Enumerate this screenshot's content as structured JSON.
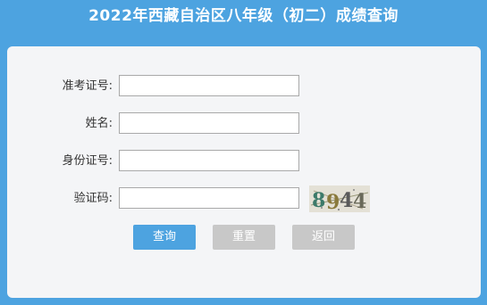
{
  "header": {
    "title": "2022年西藏自治区八年级（初二）成绩查询"
  },
  "form": {
    "fields": [
      {
        "label": "准考证号:",
        "value": "",
        "placeholder": ""
      },
      {
        "label": "姓名:",
        "value": "",
        "placeholder": ""
      },
      {
        "label": "身份证号:",
        "value": "",
        "placeholder": ""
      },
      {
        "label": "验证码:",
        "value": "",
        "placeholder": ""
      }
    ],
    "captcha_text": "8944"
  },
  "buttons": {
    "query_label": "查询",
    "reset_label": "重置",
    "back_label": "返回"
  },
  "colors": {
    "background": "#4da3e0",
    "card": "#f4f5f7",
    "primary_button": "#4da3e0",
    "secondary_button": "#c8c8c8"
  }
}
